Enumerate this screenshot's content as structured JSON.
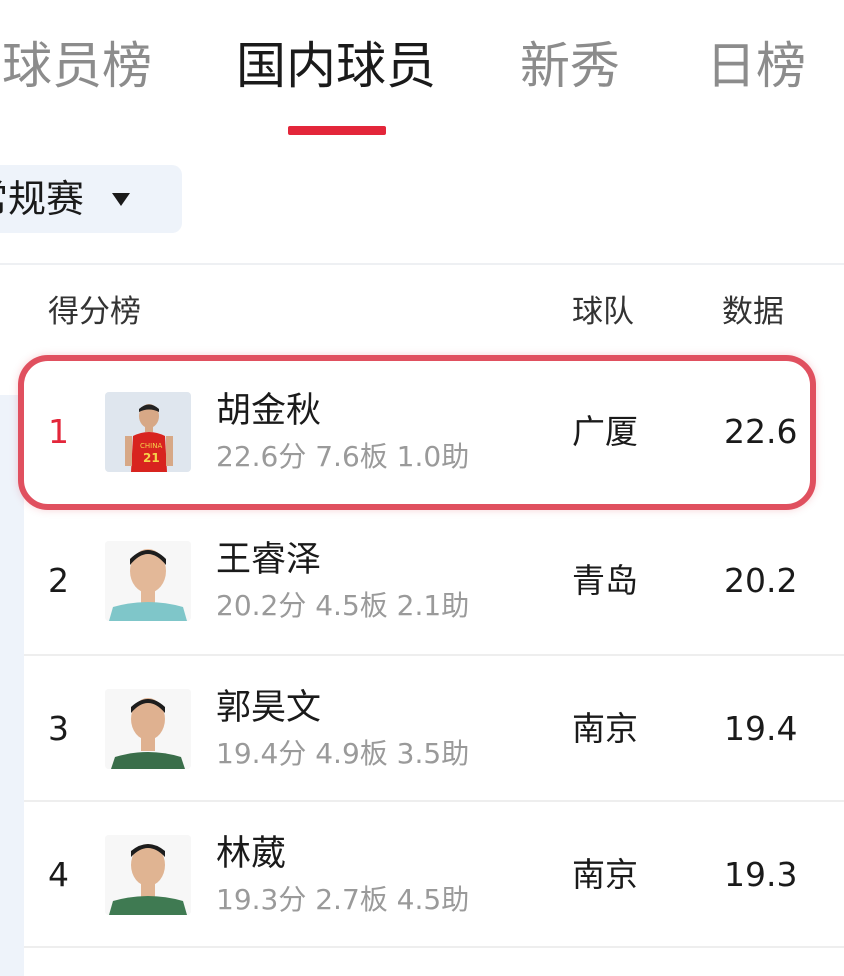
{
  "tabs": [
    {
      "label": "球员榜",
      "active": false
    },
    {
      "label": "国内球员",
      "active": true
    },
    {
      "label": "新秀",
      "active": false
    },
    {
      "label": "日榜",
      "active": false
    }
  ],
  "season_selector": {
    "label": "常规赛"
  },
  "table": {
    "headers": {
      "category": "得分榜",
      "team": "球队",
      "value": "数据"
    },
    "rows": [
      {
        "rank": "1",
        "name": "胡金秋",
        "stats": "22.6分 7.6板 1.0助",
        "team": "广厦",
        "value": "22.6",
        "highlighted": true
      },
      {
        "rank": "2",
        "name": "王睿泽",
        "stats": "20.2分 4.5板 2.1助",
        "team": "青岛",
        "value": "20.2",
        "highlighted": false
      },
      {
        "rank": "3",
        "name": "郭昊文",
        "stats": "19.4分 4.9板 3.5助",
        "team": "南京",
        "value": "19.4",
        "highlighted": false
      },
      {
        "rank": "4",
        "name": "林葳",
        "stats": "19.3分 2.7板 4.5助",
        "team": "南京",
        "value": "19.3",
        "highlighted": false
      }
    ]
  },
  "colors": {
    "accent": "#e3263a",
    "highlight_border": "#e0505f",
    "muted_text": "#9a9a9a"
  }
}
